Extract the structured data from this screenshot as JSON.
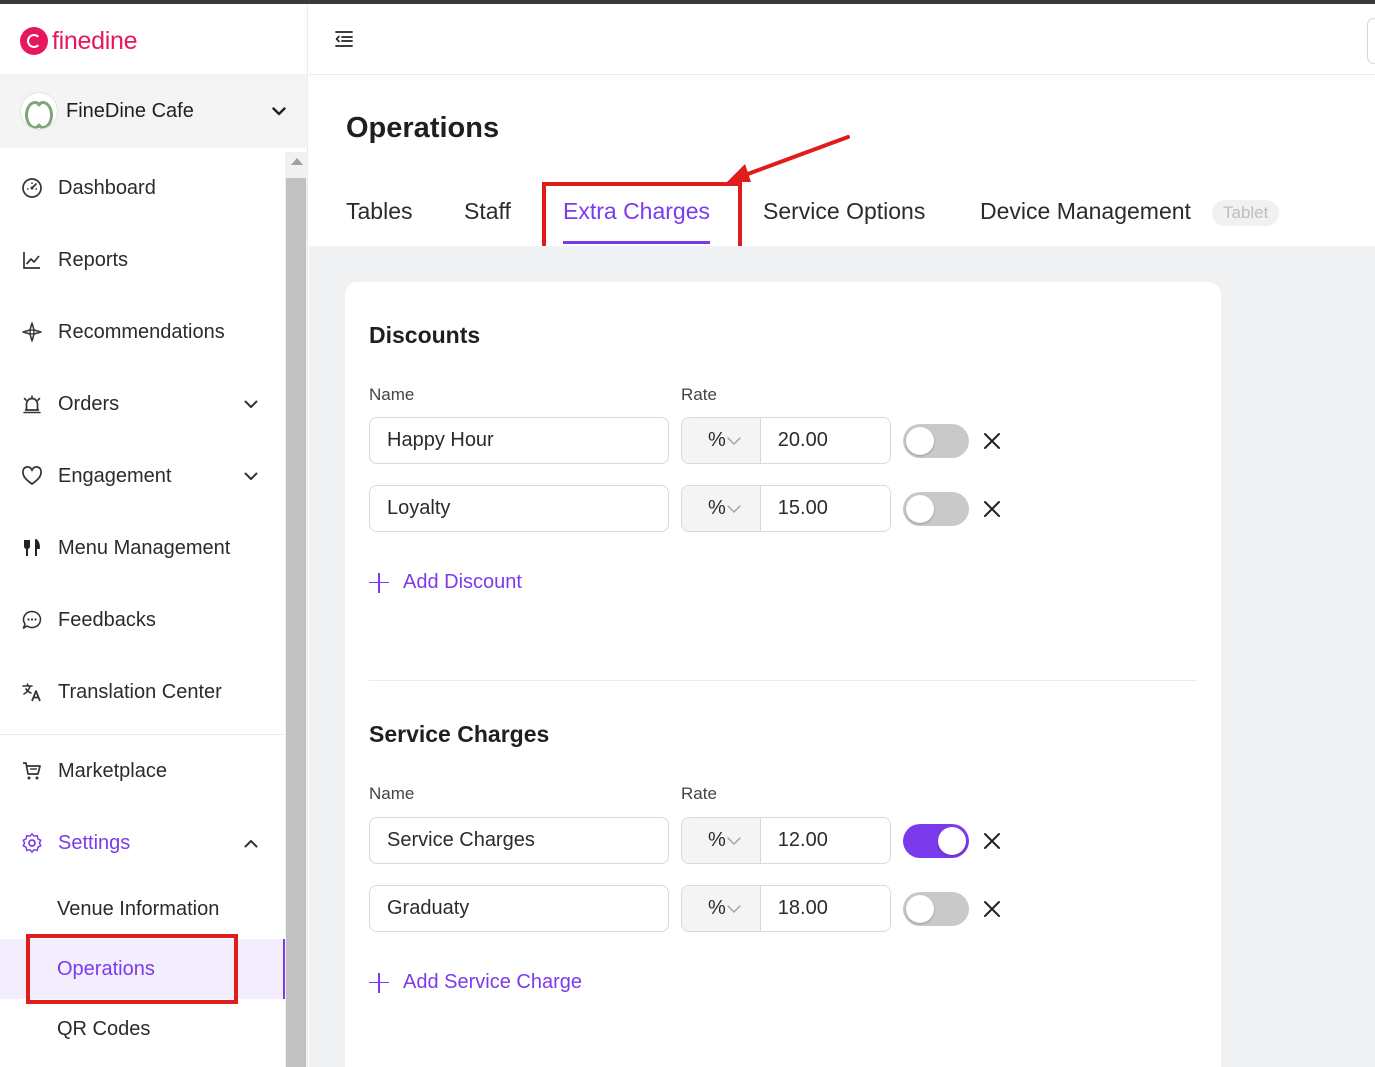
{
  "brand": {
    "name": "finedine",
    "color": "#e8155f"
  },
  "accent_color": "#7c3aed",
  "venue": {
    "name": "FineDine Cafe"
  },
  "sidebar": {
    "items": [
      {
        "label": "Dashboard",
        "icon": "gauge-icon"
      },
      {
        "label": "Reports",
        "icon": "line-chart-icon"
      },
      {
        "label": "Recommendations",
        "icon": "sparkle-icon"
      },
      {
        "label": "Orders",
        "icon": "bell-icon",
        "expandable": true
      },
      {
        "label": "Engagement",
        "icon": "heart-icon",
        "expandable": true
      },
      {
        "label": "Menu Management",
        "icon": "utensils-icon"
      },
      {
        "label": "Feedbacks",
        "icon": "chat-icon"
      },
      {
        "label": "Translation Center",
        "icon": "translate-icon"
      },
      {
        "label": "Marketplace",
        "icon": "cart-icon"
      },
      {
        "label": "Settings",
        "icon": "gear-icon",
        "expanded": true,
        "active": true
      }
    ],
    "settings_sub": [
      {
        "label": "Venue Information"
      },
      {
        "label": "Operations",
        "active": true
      },
      {
        "label": "QR Codes"
      }
    ]
  },
  "page": {
    "title": "Operations",
    "tabs": [
      {
        "label": "Tables"
      },
      {
        "label": "Staff"
      },
      {
        "label": "Extra Charges",
        "active": true
      },
      {
        "label": "Service Options"
      },
      {
        "label": "Device Management",
        "badge": "Tablet"
      }
    ]
  },
  "discounts": {
    "title": "Discounts",
    "name_label": "Name",
    "rate_label": "Rate",
    "rows": [
      {
        "name": "Happy Hour",
        "type": "%",
        "rate": "20.00",
        "enabled": false
      },
      {
        "name": "Loyalty",
        "type": "%",
        "rate": "15.00",
        "enabled": false
      }
    ],
    "add_label": "Add Discount"
  },
  "service_charges": {
    "title": "Service Charges",
    "name_label": "Name",
    "rate_label": "Rate",
    "rows": [
      {
        "name": "Service Charges",
        "type": "%",
        "rate": "12.00",
        "enabled": true
      },
      {
        "name": "Graduaty",
        "type": "%",
        "rate": "18.00",
        "enabled": false
      }
    ],
    "add_label": "Add Service Charge"
  }
}
